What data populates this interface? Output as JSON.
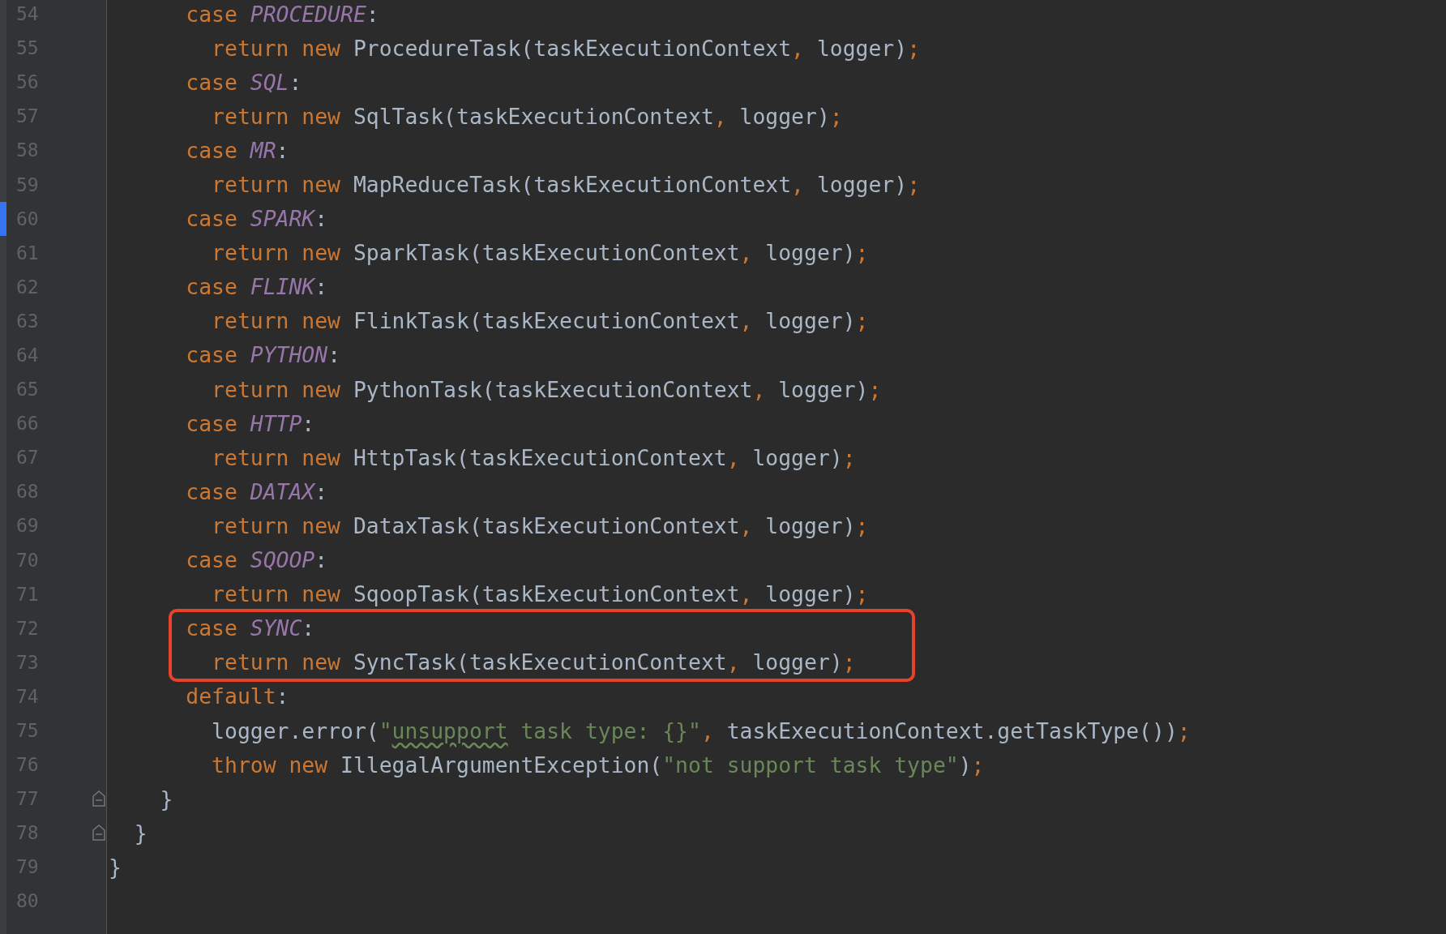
{
  "lines": [
    {
      "number": "54",
      "changed": false,
      "boxed": false,
      "fold": false,
      "tokens": [
        {
          "kind": "kw",
          "text": "      case "
        },
        {
          "kind": "enum",
          "text": "PROCEDURE"
        },
        {
          "kind": "plain",
          "text": ":"
        }
      ]
    },
    {
      "number": "55",
      "changed": false,
      "boxed": false,
      "fold": false,
      "tokens": [
        {
          "kind": "kw",
          "text": "        return new "
        },
        {
          "kind": "plain",
          "text": "ProcedureTask(taskExecutionContext"
        },
        {
          "kind": "kw",
          "text": ", "
        },
        {
          "kind": "plain",
          "text": "logger)"
        },
        {
          "kind": "kw",
          "text": ";"
        }
      ]
    },
    {
      "number": "56",
      "changed": false,
      "boxed": false,
      "fold": false,
      "tokens": [
        {
          "kind": "kw",
          "text": "      case "
        },
        {
          "kind": "enum",
          "text": "SQL"
        },
        {
          "kind": "plain",
          "text": ":"
        }
      ]
    },
    {
      "number": "57",
      "changed": false,
      "boxed": false,
      "fold": false,
      "tokens": [
        {
          "kind": "kw",
          "text": "        return new "
        },
        {
          "kind": "plain",
          "text": "SqlTask(taskExecutionContext"
        },
        {
          "kind": "kw",
          "text": ", "
        },
        {
          "kind": "plain",
          "text": "logger)"
        },
        {
          "kind": "kw",
          "text": ";"
        }
      ]
    },
    {
      "number": "58",
      "changed": false,
      "boxed": false,
      "fold": false,
      "tokens": [
        {
          "kind": "kw",
          "text": "      case "
        },
        {
          "kind": "enum",
          "text": "MR"
        },
        {
          "kind": "plain",
          "text": ":"
        }
      ]
    },
    {
      "number": "59",
      "changed": false,
      "boxed": false,
      "fold": false,
      "tokens": [
        {
          "kind": "kw",
          "text": "        return new "
        },
        {
          "kind": "plain",
          "text": "MapReduceTask(taskExecutionContext"
        },
        {
          "kind": "kw",
          "text": ", "
        },
        {
          "kind": "plain",
          "text": "logger)"
        },
        {
          "kind": "kw",
          "text": ";"
        }
      ]
    },
    {
      "number": "60",
      "changed": true,
      "boxed": false,
      "fold": false,
      "tokens": [
        {
          "kind": "kw",
          "text": "      case "
        },
        {
          "kind": "enum",
          "text": "SPARK"
        },
        {
          "kind": "plain",
          "text": ":"
        }
      ]
    },
    {
      "number": "61",
      "changed": false,
      "boxed": false,
      "fold": false,
      "tokens": [
        {
          "kind": "kw",
          "text": "        return new "
        },
        {
          "kind": "plain",
          "text": "SparkTask(taskExecutionContext"
        },
        {
          "kind": "kw",
          "text": ", "
        },
        {
          "kind": "plain",
          "text": "logger)"
        },
        {
          "kind": "kw",
          "text": ";"
        }
      ]
    },
    {
      "number": "62",
      "changed": false,
      "boxed": false,
      "fold": false,
      "tokens": [
        {
          "kind": "kw",
          "text": "      case "
        },
        {
          "kind": "enum",
          "text": "FLINK"
        },
        {
          "kind": "plain",
          "text": ":"
        }
      ]
    },
    {
      "number": "63",
      "changed": false,
      "boxed": false,
      "fold": false,
      "tokens": [
        {
          "kind": "kw",
          "text": "        return new "
        },
        {
          "kind": "plain",
          "text": "FlinkTask(taskExecutionContext"
        },
        {
          "kind": "kw",
          "text": ", "
        },
        {
          "kind": "plain",
          "text": "logger)"
        },
        {
          "kind": "kw",
          "text": ";"
        }
      ]
    },
    {
      "number": "64",
      "changed": false,
      "boxed": false,
      "fold": false,
      "tokens": [
        {
          "kind": "kw",
          "text": "      case "
        },
        {
          "kind": "enum",
          "text": "PYTHON"
        },
        {
          "kind": "plain",
          "text": ":"
        }
      ]
    },
    {
      "number": "65",
      "changed": false,
      "boxed": false,
      "fold": false,
      "tokens": [
        {
          "kind": "kw",
          "text": "        return new "
        },
        {
          "kind": "plain",
          "text": "PythonTask(taskExecutionContext"
        },
        {
          "kind": "kw",
          "text": ", "
        },
        {
          "kind": "plain",
          "text": "logger)"
        },
        {
          "kind": "kw",
          "text": ";"
        }
      ]
    },
    {
      "number": "66",
      "changed": false,
      "boxed": false,
      "fold": false,
      "tokens": [
        {
          "kind": "kw",
          "text": "      case "
        },
        {
          "kind": "enum",
          "text": "HTTP"
        },
        {
          "kind": "plain",
          "text": ":"
        }
      ]
    },
    {
      "number": "67",
      "changed": false,
      "boxed": false,
      "fold": false,
      "tokens": [
        {
          "kind": "kw",
          "text": "        return new "
        },
        {
          "kind": "plain",
          "text": "HttpTask(taskExecutionContext"
        },
        {
          "kind": "kw",
          "text": ", "
        },
        {
          "kind": "plain",
          "text": "logger)"
        },
        {
          "kind": "kw",
          "text": ";"
        }
      ]
    },
    {
      "number": "68",
      "changed": false,
      "boxed": false,
      "fold": false,
      "tokens": [
        {
          "kind": "kw",
          "text": "      case "
        },
        {
          "kind": "enum",
          "text": "DATAX"
        },
        {
          "kind": "plain",
          "text": ":"
        }
      ]
    },
    {
      "number": "69",
      "changed": false,
      "boxed": false,
      "fold": false,
      "tokens": [
        {
          "kind": "kw",
          "text": "        return new "
        },
        {
          "kind": "plain",
          "text": "DataxTask(taskExecutionContext"
        },
        {
          "kind": "kw",
          "text": ", "
        },
        {
          "kind": "plain",
          "text": "logger)"
        },
        {
          "kind": "kw",
          "text": ";"
        }
      ]
    },
    {
      "number": "70",
      "changed": false,
      "boxed": false,
      "fold": false,
      "tokens": [
        {
          "kind": "kw",
          "text": "      case "
        },
        {
          "kind": "enum",
          "text": "SQOOP"
        },
        {
          "kind": "plain",
          "text": ":"
        }
      ]
    },
    {
      "number": "71",
      "changed": false,
      "boxed": false,
      "fold": false,
      "tokens": [
        {
          "kind": "kw",
          "text": "        return new "
        },
        {
          "kind": "plain",
          "text": "SqoopTask(taskExecutionContext"
        },
        {
          "kind": "kw",
          "text": ", "
        },
        {
          "kind": "plain",
          "text": "logger)"
        },
        {
          "kind": "kw",
          "text": ";"
        }
      ]
    },
    {
      "number": "72",
      "changed": false,
      "boxed": true,
      "fold": false,
      "tokens": [
        {
          "kind": "kw",
          "text": "      case "
        },
        {
          "kind": "enum",
          "text": "SYNC"
        },
        {
          "kind": "plain",
          "text": ":"
        }
      ]
    },
    {
      "number": "73",
      "changed": false,
      "boxed": true,
      "fold": false,
      "tokens": [
        {
          "kind": "kw",
          "text": "        return new "
        },
        {
          "kind": "plain",
          "text": "SyncTask(taskExecutionContext"
        },
        {
          "kind": "kw",
          "text": ", "
        },
        {
          "kind": "plain",
          "text": "logger)"
        },
        {
          "kind": "kw",
          "text": ";"
        }
      ]
    },
    {
      "number": "74",
      "changed": false,
      "boxed": false,
      "fold": false,
      "tokens": [
        {
          "kind": "kw",
          "text": "      default"
        },
        {
          "kind": "plain",
          "text": ":"
        }
      ]
    },
    {
      "number": "75",
      "changed": false,
      "boxed": false,
      "fold": false,
      "tokens": [
        {
          "kind": "plain",
          "text": "        logger.error("
        },
        {
          "kind": "str",
          "text": "\""
        },
        {
          "kind": "typo",
          "text": "unsupport"
        },
        {
          "kind": "str",
          "text": " task type: {}\""
        },
        {
          "kind": "kw",
          "text": ", "
        },
        {
          "kind": "plain",
          "text": "taskExecutionContext.getTaskType())"
        },
        {
          "kind": "kw",
          "text": ";"
        }
      ]
    },
    {
      "number": "76",
      "changed": false,
      "boxed": false,
      "fold": false,
      "tokens": [
        {
          "kind": "kw",
          "text": "        throw new "
        },
        {
          "kind": "plain",
          "text": "IllegalArgumentException("
        },
        {
          "kind": "str",
          "text": "\"not support task type\""
        },
        {
          "kind": "plain",
          "text": ")"
        },
        {
          "kind": "kw",
          "text": ";"
        }
      ]
    },
    {
      "number": "77",
      "changed": false,
      "boxed": false,
      "fold": true,
      "tokens": [
        {
          "kind": "plain",
          "text": "    }"
        }
      ]
    },
    {
      "number": "78",
      "changed": false,
      "boxed": false,
      "fold": true,
      "tokens": [
        {
          "kind": "plain",
          "text": "  }"
        }
      ]
    },
    {
      "number": "79",
      "changed": false,
      "boxed": false,
      "fold": false,
      "tokens": [
        {
          "kind": "plain",
          "text": "}"
        }
      ]
    },
    {
      "number": "80",
      "changed": false,
      "boxed": false,
      "fold": false
    }
  ]
}
